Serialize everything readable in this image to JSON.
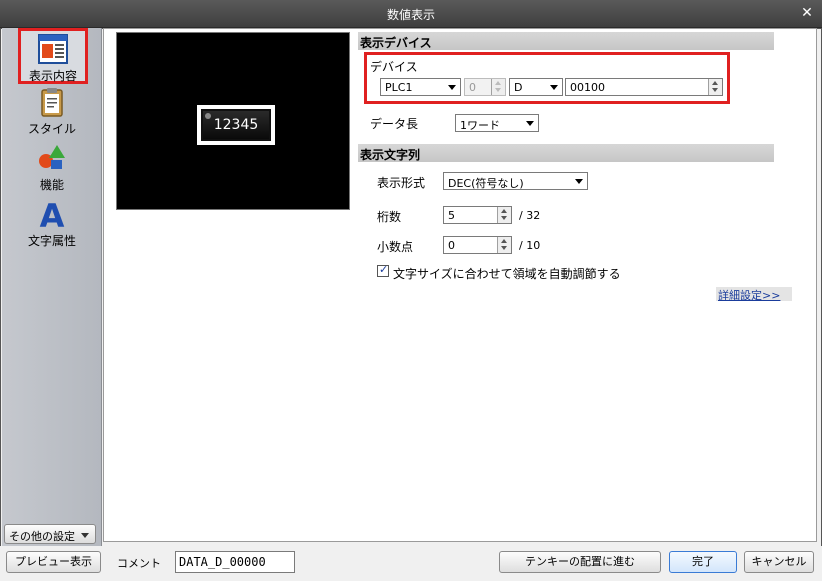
{
  "window": {
    "title": "数値表示"
  },
  "sidebar": {
    "items": [
      {
        "label": "表示内容",
        "icon": "display-content-icon"
      },
      {
        "label": "スタイル",
        "icon": "style-clipboard-icon"
      },
      {
        "label": "機能",
        "icon": "function-shapes-icon"
      },
      {
        "label": "文字属性",
        "icon": "text-attribute-icon"
      }
    ],
    "other_settings": "その他の設定"
  },
  "preview": {
    "value": "12345"
  },
  "device_section": {
    "title": "表示デバイス",
    "device_label": "デバイス",
    "plc": "PLC1",
    "station": "0",
    "device_type": "D",
    "address": "00100",
    "data_length_label": "データ長",
    "data_length": "1ワード"
  },
  "string_section": {
    "title": "表示文字列",
    "format_label": "表示形式",
    "format": "DEC(符号なし)",
    "digits_label": "桁数",
    "digits": "5",
    "digits_max": "/ 32",
    "decimal_label": "小数点",
    "decimal": "0",
    "decimal_max": "/ 10",
    "autofit_label": "文字サイズに合わせて領域を自動調節する",
    "autofit_checked": true,
    "detail_link": "詳細設定>>"
  },
  "bottom": {
    "preview_button": "プレビュー表示",
    "comment_label": "コメント",
    "comment_value": "DATA_D_00000",
    "tenkey_button": "テンキーの配置に進む",
    "ok_button": "完了",
    "cancel_button": "キャンセル"
  },
  "colors": {
    "highlight": "#e02020",
    "link": "#1a3c9c",
    "titlebar": "#4a4a4a"
  }
}
